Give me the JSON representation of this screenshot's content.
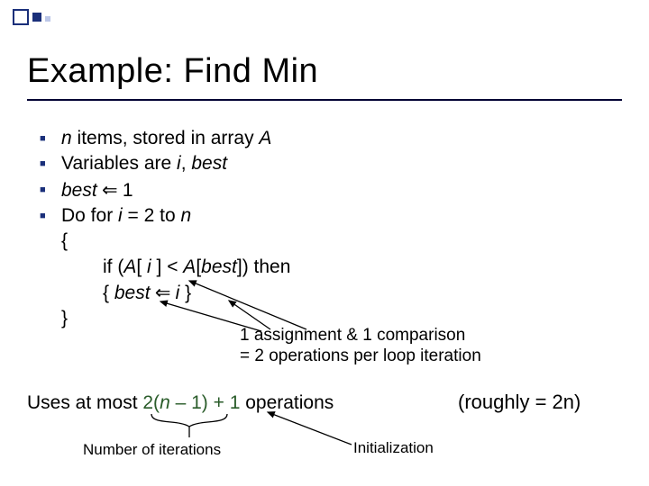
{
  "title": "Example: Find Min",
  "bullets": {
    "b1_pre": "",
    "b1_n": "n",
    "b1_mid": " items, stored in array ",
    "b1_A": "A",
    "b2_pre": "Variables are ",
    "b2_i": "i",
    "b2_comma": ", ",
    "b2_best": "best",
    "b3_best": "best",
    "b3_arrow": " ⇐ ",
    "b3_one": "1",
    "b4_pre": "Do for ",
    "b4_i": "i",
    "b4_eq": " = 2 to ",
    "b4_n": "n"
  },
  "code": {
    "open": "{",
    "if_pre": "if (",
    "if_A1": "A",
    "if_mid1": "[ ",
    "if_i": "i",
    "if_mid2": " ] < ",
    "if_A2": "A",
    "if_mid3": "[",
    "if_best": "best",
    "if_mid4": "]) then",
    "body_open": "{ ",
    "body_best": "best",
    "body_arrow": " ⇐ ",
    "body_i": "i",
    "body_close": " }",
    "close": "}"
  },
  "annot1a": "1 assignment & 1 comparison",
  "annot1b": "= 2 operations per loop iteration",
  "uses_pre": "Uses at most ",
  "uses_main": "2(",
  "uses_n": "n",
  "uses_mid": " – 1) + 1",
  "uses_post": " operations",
  "roughly": "(roughly = 2n)",
  "iterlabel": "Number of iterations",
  "initlabel": "Initialization"
}
